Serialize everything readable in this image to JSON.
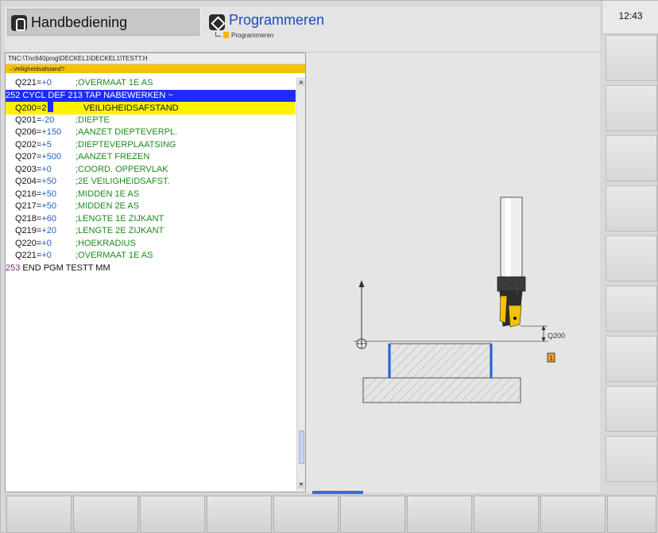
{
  "header": {
    "mode_left_label": "Handbediening",
    "mode_right_label": "Programmeren",
    "sub_label": "Programmeren",
    "clock": "12:43"
  },
  "program": {
    "path": "TNC:\\Tnc640prog\\DECKEL1\\DECKEL1\\TESTT.H",
    "prompt": "→Veiligheidsafstand?",
    "lines": [
      {
        "param": "Q221=",
        "value": "+0",
        "comment": ";OVERMAAT 1E AS"
      },
      {
        "text": "252 CYCL DEF 213 TAP NABEWERKEN ~"
      },
      {
        "param": "Q200=",
        "value": "2",
        "comment": "VEILIGHEIDSAFSTAND"
      },
      {
        "param": "Q201=",
        "value": "-20",
        "comment": ";DIEPTE"
      },
      {
        "param": "Q206=",
        "value": "+150",
        "comment": ";AANZET DIEPTEVERPL."
      },
      {
        "param": "Q202=",
        "value": "+5",
        "comment": ";DIEPTEVERPLAATSING"
      },
      {
        "param": "Q207=",
        "value": "+500",
        "comment": ";AANZET FREZEN"
      },
      {
        "param": "Q203=",
        "value": "+0",
        "comment": ";COORD. OPPERVLAK"
      },
      {
        "param": "Q204=",
        "value": "+50",
        "comment": ";2E VEILIGHEIDSAFST."
      },
      {
        "param": "Q216=",
        "value": "+50",
        "comment": ";MIDDEN 1E AS"
      },
      {
        "param": "Q217=",
        "value": "+50",
        "comment": ";MIDDEN 2E AS"
      },
      {
        "param": "Q218=",
        "value": "+60",
        "comment": ";LENGTE 1E ZIJKANT"
      },
      {
        "param": "Q219=",
        "value": "+20",
        "comment": ";LENGTE 2E ZIJKANT"
      },
      {
        "param": "Q220=",
        "value": "+0",
        "comment": ";HOEKRADIUS"
      },
      {
        "param": "Q221=",
        "value": "+0",
        "comment": ";OVERMAAT 1E AS"
      },
      {
        "num": "253",
        "text": " END PGM TESTT MM"
      }
    ]
  },
  "graphic": {
    "dimension_label": "Q200",
    "marker_label": "1",
    "colors": {
      "tool_yellow": "#f2c200",
      "wall_blue": "#1f5fd0",
      "marker_orange": "#f0a52a"
    }
  }
}
